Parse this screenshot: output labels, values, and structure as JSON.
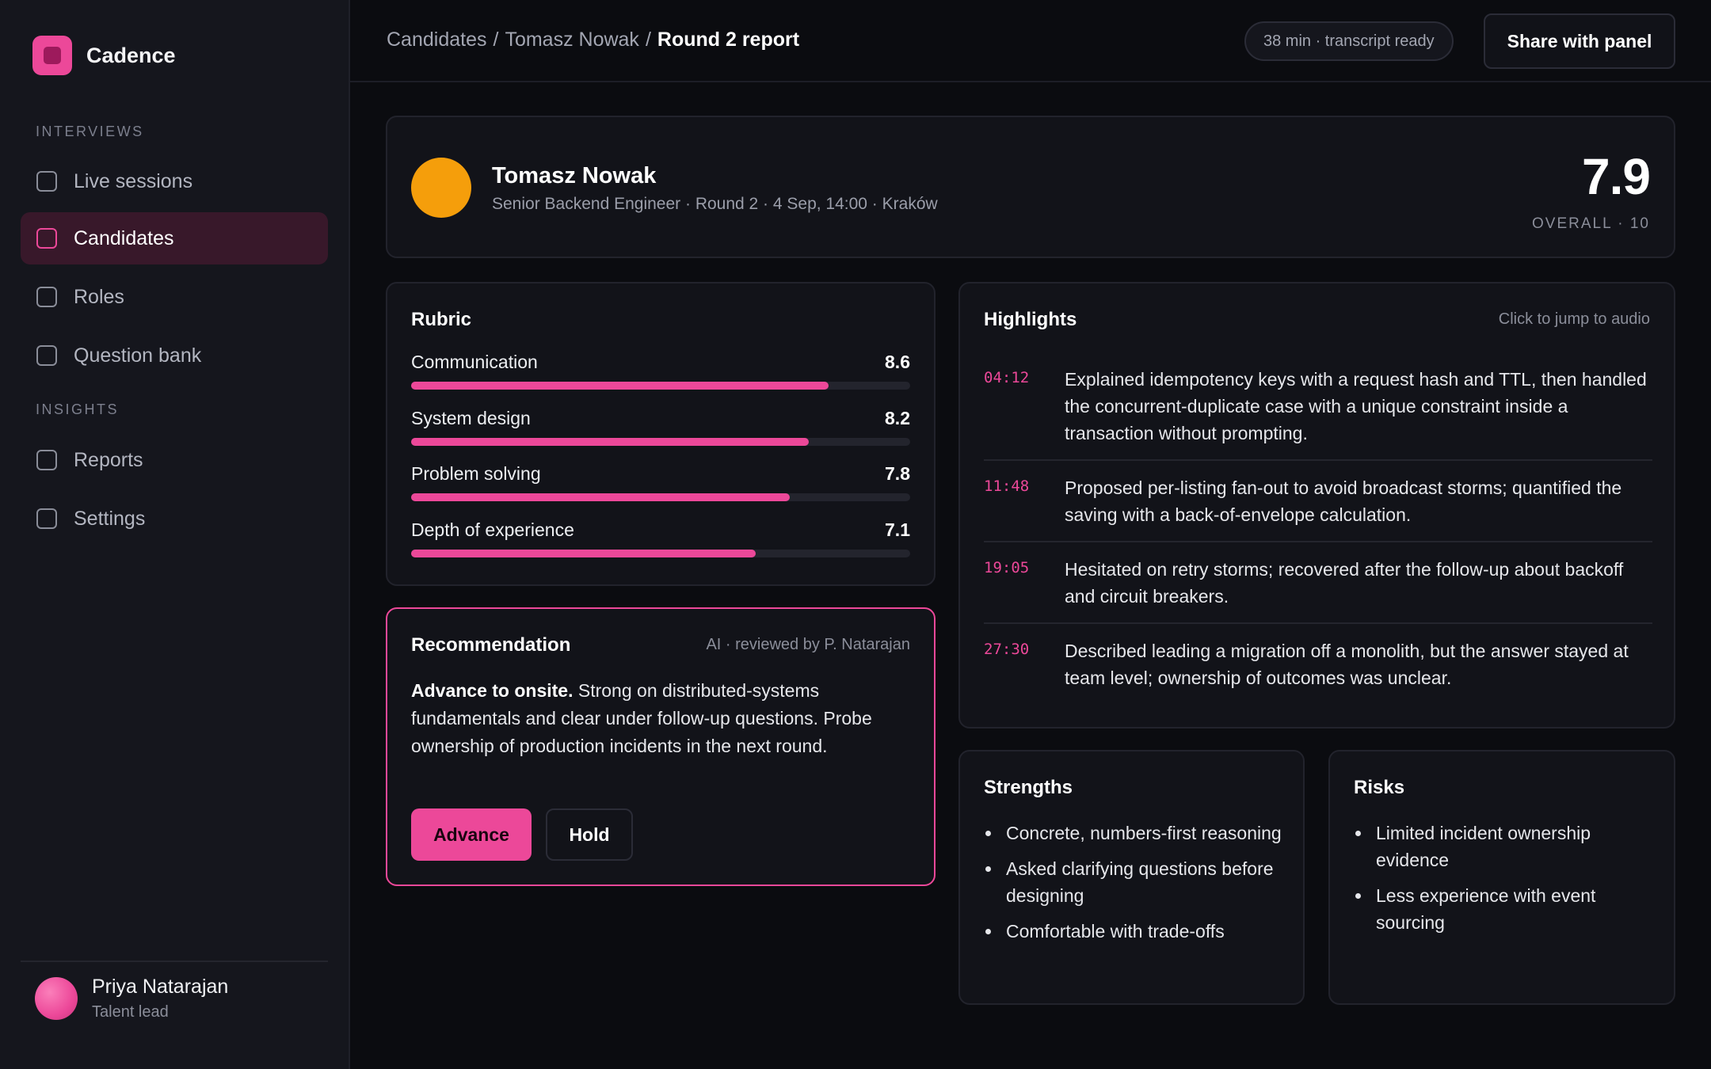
{
  "brand": {
    "name": "Cadence"
  },
  "sidebar": {
    "sections": [
      {
        "label": "INTERVIEWS"
      },
      {
        "label": "INSIGHTS"
      }
    ],
    "items": [
      {
        "label": "Live sessions"
      },
      {
        "label": "Candidates",
        "active": true
      },
      {
        "label": "Roles"
      },
      {
        "label": "Question bank"
      },
      {
        "label": "Reports"
      },
      {
        "label": "Settings"
      }
    ],
    "user": {
      "name": "Priya Natarajan",
      "role": "Talent lead"
    }
  },
  "header": {
    "breadcrumb": [
      "Candidates",
      "Tomasz Nowak",
      "Round 2 report"
    ],
    "separator": "/",
    "status": "38 min · transcript ready",
    "share_label": "Share with panel"
  },
  "candidate": {
    "name": "Tomasz Nowak",
    "subtitle": "Senior Backend Engineer · Round 2 · 4 Sep, 14:00 · Kraków",
    "score": "7.9",
    "score_label": "OVERALL · 10",
    "avatar_color": "#f59e0b"
  },
  "rubric": {
    "title": "Rubric",
    "items": [
      {
        "label": "Communication",
        "value": "8.6",
        "level": 0.836
      },
      {
        "label": "System design",
        "value": "8.2",
        "level": 0.797
      },
      {
        "label": "Problem solving",
        "value": "7.8",
        "level": 0.758
      },
      {
        "label": "Depth of experience",
        "value": "7.1",
        "level": 0.69
      }
    ]
  },
  "recommendation": {
    "title": "Recommendation",
    "meta": "AI · reviewed by P. Natarajan",
    "lead": "Advance to onsite.",
    "body": " Strong on distributed-systems fundamentals and clear under follow-up questions. Probe ownership of production incidents in the next round.",
    "advance_label": "Advance",
    "hold_label": "Hold"
  },
  "highlights": {
    "title": "Highlights",
    "hint": "Click to jump to audio",
    "items": [
      {
        "time": "04:12",
        "text": "Explained idempotency keys with a request hash and TTL, then handled the concurrent-duplicate case with a unique constraint inside a transaction without prompting."
      },
      {
        "time": "11:48",
        "text": "Proposed per-listing fan-out to avoid broadcast storms; quantified the saving with a back-of-envelope calculation."
      },
      {
        "time": "19:05",
        "text": "Hesitated on retry storms; recovered after the follow-up about backoff and circuit breakers."
      },
      {
        "time": "27:30",
        "text": "Described leading a migration off a monolith, but the answer stayed at team level; ownership of outcomes was unclear."
      }
    ]
  },
  "strengths": {
    "title": "Strengths",
    "items": [
      "Concrete, numbers-first reasoning",
      "Asked clarifying questions before designing",
      "Comfortable with trade-offs"
    ]
  },
  "risks": {
    "title": "Risks",
    "items": [
      "Limited incident ownership evidence",
      "Less experience with event sourcing"
    ]
  },
  "colors": {
    "accent": "#ec4899",
    "background": "#0b0c10",
    "sidebar": "#15161d",
    "card": "#121319"
  }
}
